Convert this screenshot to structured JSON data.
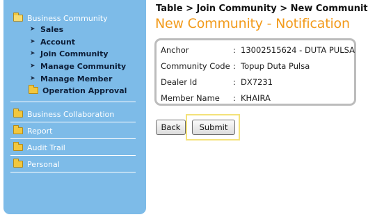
{
  "sidebar": {
    "business_community": {
      "label": "Business Community",
      "items": [
        {
          "label": "Sales"
        },
        {
          "label": "Account"
        },
        {
          "label": "Join Community"
        },
        {
          "label": "Manage Community"
        },
        {
          "label": "Manage Member"
        }
      ],
      "operation_approval": "Operation Approval"
    },
    "groups": [
      {
        "label": "Business Collaboration"
      },
      {
        "label": "Report"
      },
      {
        "label": "Audit Trail"
      },
      {
        "label": "Personal"
      }
    ]
  },
  "main": {
    "breadcrumb": "Table > Join Community > New Community",
    "title": "New Community - Notification",
    "colon": ":",
    "details": [
      {
        "label": "Anchor",
        "value": "13002515624 - DUTA PULSA"
      },
      {
        "label": "Community Code",
        "value": "Topup Duta Pulsa"
      },
      {
        "label": "Dealer Id",
        "value": "DX7231"
      },
      {
        "label": "Member Name",
        "value": "KHAIRA"
      }
    ],
    "buttons": {
      "back": "Back",
      "submit": "Submit"
    }
  },
  "icons": {
    "folder": "folder-icon",
    "folder_open": "folder-open-icon",
    "bullet": "bullet-arrow-icon"
  },
  "colors": {
    "sidebar_bg": "#7dbbe8",
    "title_accent": "#f29a1a",
    "focus_highlight": "#f4e27a"
  }
}
